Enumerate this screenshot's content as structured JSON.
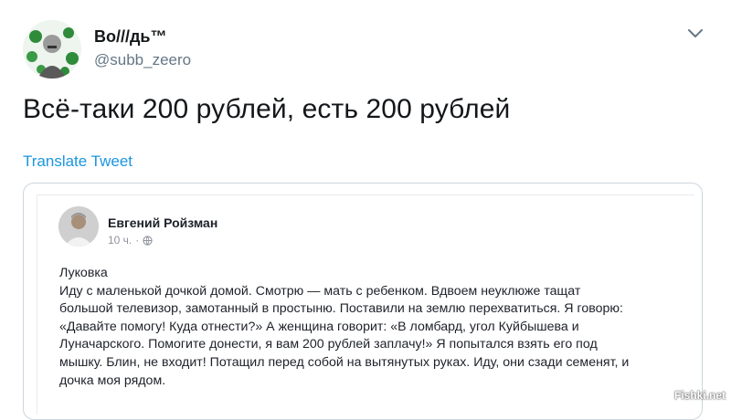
{
  "tweet": {
    "author_name": "Во///дь™",
    "author_handle": "@subb_zeero",
    "text": "Всё-таки 200 рублей, есть 200 рублей",
    "translate_label": "Translate Tweet",
    "menu_icon": "chevron-down-icon"
  },
  "quoted_post": {
    "author_name": "Евгений Ройзман",
    "time": "10 ч.",
    "separator": "·",
    "privacy_icon": "globe-icon",
    "title": "Луковка",
    "lines": [
      "Иду с маленькой дочкой домой. Смотрю — мать с ребенком. Вдвоем неуклюже тащат",
      "большой телевизор, замотанный в простыню. Поставили на землю перехватиться. Я говорю:",
      "«Давайте помогу! Куда отнести?» А женщина говорит: «В ломбард, угол Куйбышева и",
      "Луначарского. Помогите донести, я вам 200 рублей заплачу!» Я попытался взять его под",
      "мышку. Блин, не входит! Потащил перед собой на вытянутых руках. Иду, они сзади семенят, и",
      "дочка моя рядом."
    ]
  },
  "watermark": "Fishki.net",
  "colors": {
    "link": "#1b95e0",
    "handle": "#657786",
    "card_border": "#ccd6dd"
  }
}
